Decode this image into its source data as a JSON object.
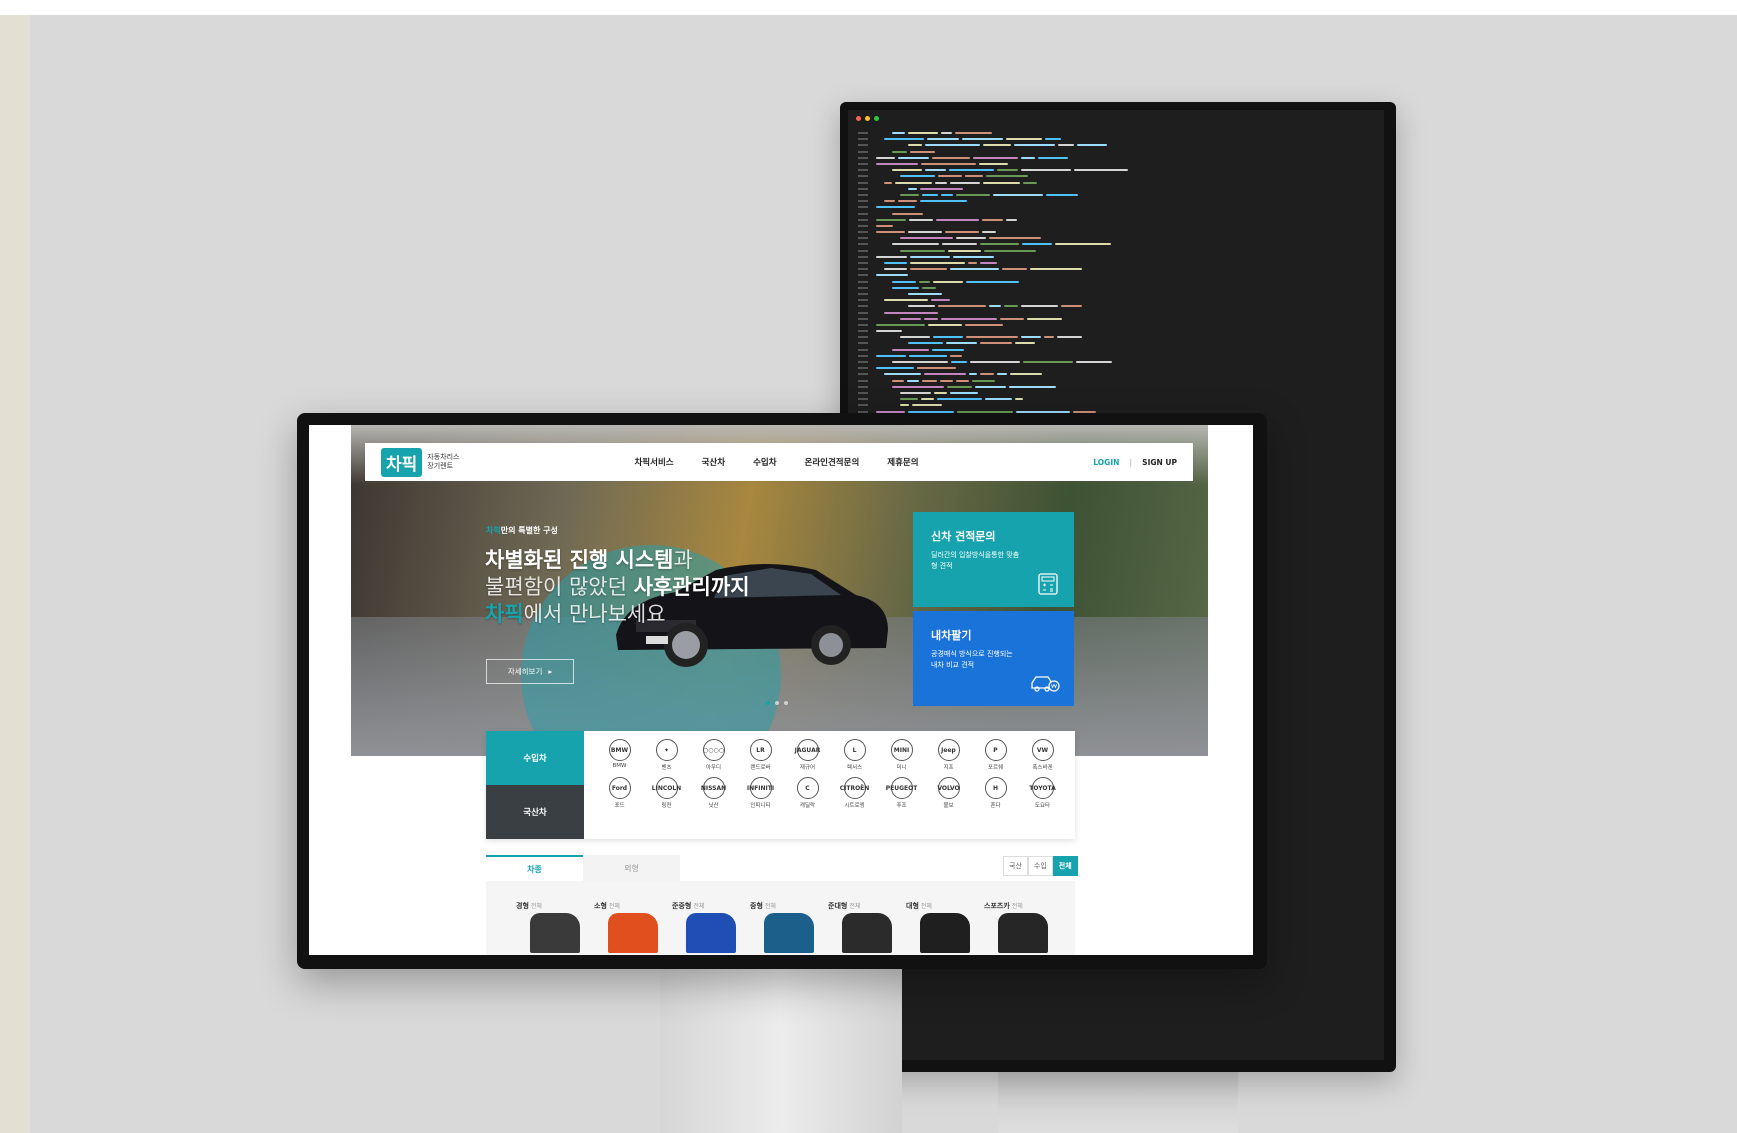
{
  "site": {
    "logo": "차픽",
    "logo_sub_line1": "자동차리스",
    "logo_sub_line2": "장기렌트",
    "nav": [
      "차픽서비스",
      "국산차",
      "수입차",
      "온라인견적문의",
      "제휴문의"
    ],
    "login": "LOGIN",
    "signup": "SIGN UP",
    "separator": "|"
  },
  "hero": {
    "eyebrow_accent": "차픽",
    "eyebrow_rest": "만의 특별한 구성",
    "line1_bold": "차별화된 진행 시스템",
    "line1_light": "과",
    "line2_light": "불편함이 많았던 ",
    "line2_bold": "사후관리까지",
    "line3_accent": "차픽",
    "line3_light": "에서 만나보세요",
    "more_label": "자세히보기",
    "more_arrow": "▸"
  },
  "cards": {
    "new_car": {
      "title": "신차 견적문의",
      "desc": "딜러간의 입찰방식을통한 맞춤형 견적",
      "icon": "calculator-icon"
    },
    "sell_car": {
      "title": "내차팔기",
      "desc": "공경매식 방식으로 진행되는 내차 비교 견적",
      "icon": "car-won-icon"
    }
  },
  "brand_tabs": {
    "import": "수입차",
    "domestic": "국산차"
  },
  "brands": [
    {
      "abbr": "BMW",
      "name": "BMW"
    },
    {
      "abbr": "✦",
      "name": "벤츠"
    },
    {
      "abbr": "○○○○",
      "name": "아우디"
    },
    {
      "abbr": "LR",
      "name": "랜드로버"
    },
    {
      "abbr": "JAGUAR",
      "name": "재규어"
    },
    {
      "abbr": "L",
      "name": "렉서스"
    },
    {
      "abbr": "MINI",
      "name": "미니"
    },
    {
      "abbr": "Jeep",
      "name": "지프"
    },
    {
      "abbr": "P",
      "name": "포르쉐"
    },
    {
      "abbr": "VW",
      "name": "폭스바겐"
    },
    {
      "abbr": "Ford",
      "name": "포드"
    },
    {
      "abbr": "LINCOLN",
      "name": "링컨"
    },
    {
      "abbr": "NISSAN",
      "name": "닛산"
    },
    {
      "abbr": "INFINITI",
      "name": "인피니티"
    },
    {
      "abbr": "C",
      "name": "캐딜락"
    },
    {
      "abbr": "CITROËN",
      "name": "시트로엥"
    },
    {
      "abbr": "PEUGEOT",
      "name": "푸조"
    },
    {
      "abbr": "VOLVO",
      "name": "볼보"
    },
    {
      "abbr": "H",
      "name": "혼다"
    },
    {
      "abbr": "TOYOTA",
      "name": "도요타"
    }
  ],
  "type_tabs": [
    "차종",
    "외형"
  ],
  "filter": [
    "국산",
    "수입",
    "전체"
  ],
  "car_types": [
    {
      "label": "경형",
      "all": "전체",
      "color": "#3a3a3a"
    },
    {
      "label": "소형",
      "all": "전체",
      "color": "#e0501f"
    },
    {
      "label": "준중형",
      "all": "전체",
      "color": "#1f4fb5"
    },
    {
      "label": "중형",
      "all": "전체",
      "color": "#1b5f8a"
    },
    {
      "label": "준대형",
      "all": "전체",
      "color": "#2b2b2b"
    },
    {
      "label": "대형",
      "all": "전체",
      "color": "#1f1f1f"
    },
    {
      "label": "스포츠카",
      "all": "전체",
      "color": "#262626"
    }
  ],
  "colors": {
    "accent": "#16a3ad",
    "blue_card": "#1a73d9",
    "dark_tab": "#3a3f44",
    "editor_bg": "#1e1e1e"
  }
}
